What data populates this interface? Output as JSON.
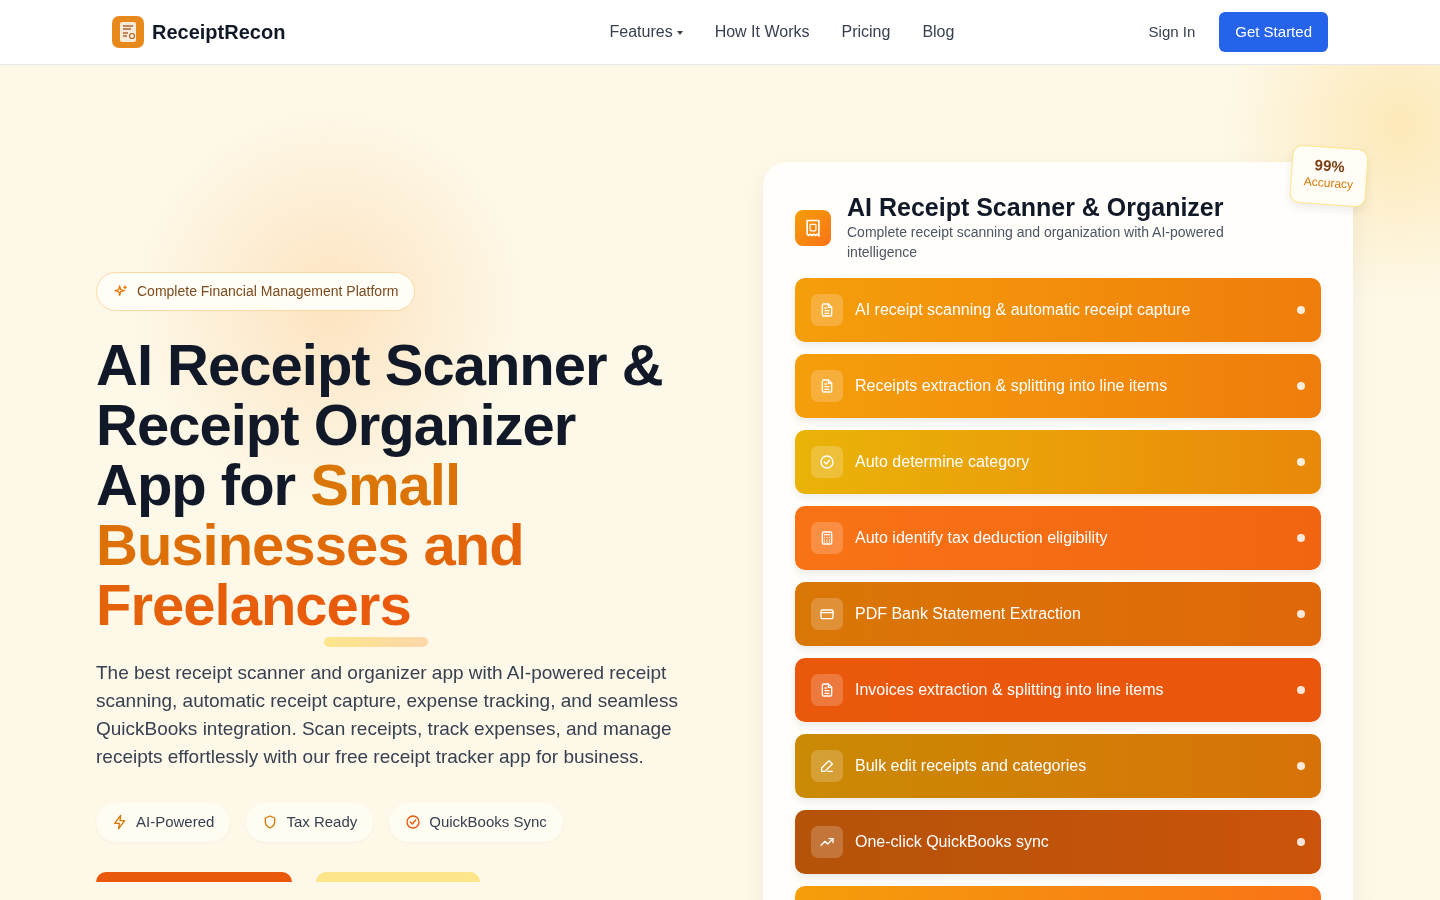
{
  "brand": {
    "name": "ReceiptRecon"
  },
  "nav": [
    {
      "label": "Features",
      "dropdown": true
    },
    {
      "label": "How It Works",
      "dropdown": false
    },
    {
      "label": "Pricing",
      "dropdown": false
    },
    {
      "label": "Blog",
      "dropdown": false
    }
  ],
  "sign_in": "Sign In",
  "get_started": "Get Started",
  "hero": {
    "badge": "Complete Financial Management Platform",
    "title": "AI Receipt Scanner & Receipt Organizer App for",
    "title_highlight": "Small Businesses and Freelancers",
    "description": "The best receipt scanner and organizer app with AI-powered receipt scanning, automatic receipt capture, expense tracking, and seamless QuickBooks integration. Scan receipts, track expenses, and manage receipts effortlessly with our free receipt tracker app for business.",
    "pills": [
      {
        "kind": "bolt",
        "label": "AI-Powered"
      },
      {
        "kind": "shield",
        "label": "Tax Ready"
      },
      {
        "kind": "check",
        "label": "QuickBooks Sync"
      }
    ]
  },
  "card": {
    "title": "AI Receipt Scanner & Organizer",
    "subtitle": "Complete receipt scanning and organization with AI-powered intelligence",
    "stat_value": "99%",
    "stat_label": "Accuracy",
    "features": [
      {
        "kind": "doc",
        "label": "AI receipt scanning & automatic receipt capture",
        "color": "#f59e0b"
      },
      {
        "kind": "doc",
        "label": "Receipts extraction & splitting into line items",
        "color": "#f59e0b"
      },
      {
        "kind": "check",
        "label": "Auto determine category",
        "color": "#eab308"
      },
      {
        "kind": "calc",
        "label": "Auto identify tax deduction eligibility",
        "color": "#f97316"
      },
      {
        "kind": "card",
        "label": "PDF Bank Statement Extraction",
        "color": "#d97706"
      },
      {
        "kind": "doc",
        "label": "Invoices extraction & splitting into line items",
        "color": "#ea580c"
      },
      {
        "kind": "pen",
        "label": "Bulk edit receipts and categories",
        "color": "#ca8a04"
      },
      {
        "kind": "trend",
        "label": "One-click QuickBooks sync",
        "color": "#b45309"
      }
    ]
  }
}
